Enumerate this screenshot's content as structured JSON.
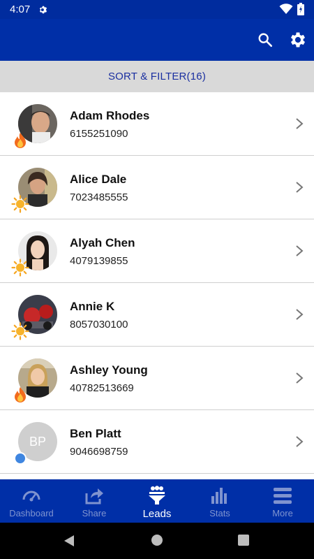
{
  "status_bar": {
    "time": "4:07"
  },
  "sort_filter": {
    "label": "SORT & FILTER(16)"
  },
  "leads": [
    {
      "name": "Adam Rhodes",
      "phone": "6155251090",
      "badge": "fire-icon",
      "avatar": "photo"
    },
    {
      "name": "Alice Dale",
      "phone": "7023485555",
      "badge": "sun-icon",
      "avatar": "photo"
    },
    {
      "name": "Alyah Chen",
      "phone": "4079139855",
      "badge": "sun-icon",
      "avatar": "photo"
    },
    {
      "name": "Annie K",
      "phone": "8057030100",
      "badge": "sun-icon",
      "avatar": "photo"
    },
    {
      "name": "Ashley Young",
      "phone": "40782513669",
      "badge": "fire-icon",
      "avatar": "photo"
    },
    {
      "name": "Ben Platt",
      "phone": "9046698759",
      "badge": "dot",
      "avatar": "initials",
      "initials": "BP"
    }
  ],
  "bottom_nav": [
    {
      "label": "Dashboard",
      "icon": "speedometer-icon",
      "active": false
    },
    {
      "label": "Share",
      "icon": "share-icon",
      "active": false
    },
    {
      "label": "Leads",
      "icon": "funnel-people-icon",
      "active": true
    },
    {
      "label": "Stats",
      "icon": "bar-chart-icon",
      "active": false
    },
    {
      "label": "More",
      "icon": "menu-icon",
      "active": false
    }
  ],
  "colors": {
    "primary": "#002fa7",
    "status": "#002c9e",
    "sort_text": "#1a2fa0",
    "inactive_nav": "#7f93cf"
  }
}
